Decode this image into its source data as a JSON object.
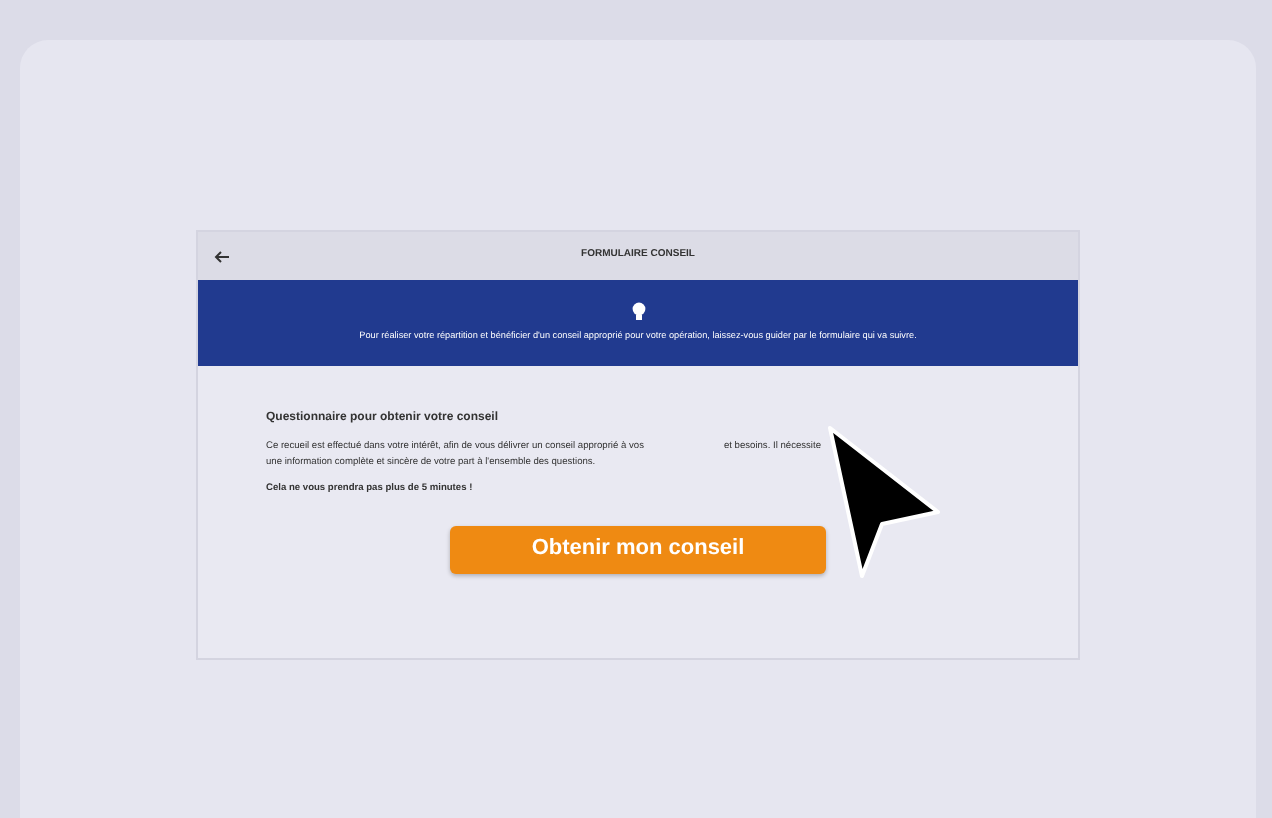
{
  "header": {
    "title": "FORMULAIRE CONSEIL"
  },
  "banner": {
    "text": "Pour réaliser votre répartition et bénéficier d'un conseil approprié pour votre opération, laissez-vous guider par le formulaire qui va suivre."
  },
  "questionnaire": {
    "heading": "Questionnaire pour obtenir votre conseil",
    "paragraph_start": "Ce recueil est effectué dans votre intérêt, afin de vous délivrer un conseil approprié à vos",
    "paragraph_end": "et besoins. Il nécessite",
    "paragraph_second_line": "une information complète et sincère de votre part à l'ensemble des questions.",
    "note": "Cela ne vous prendra pas plus de 5 minutes !",
    "button": "Obtenir mon conseil"
  }
}
